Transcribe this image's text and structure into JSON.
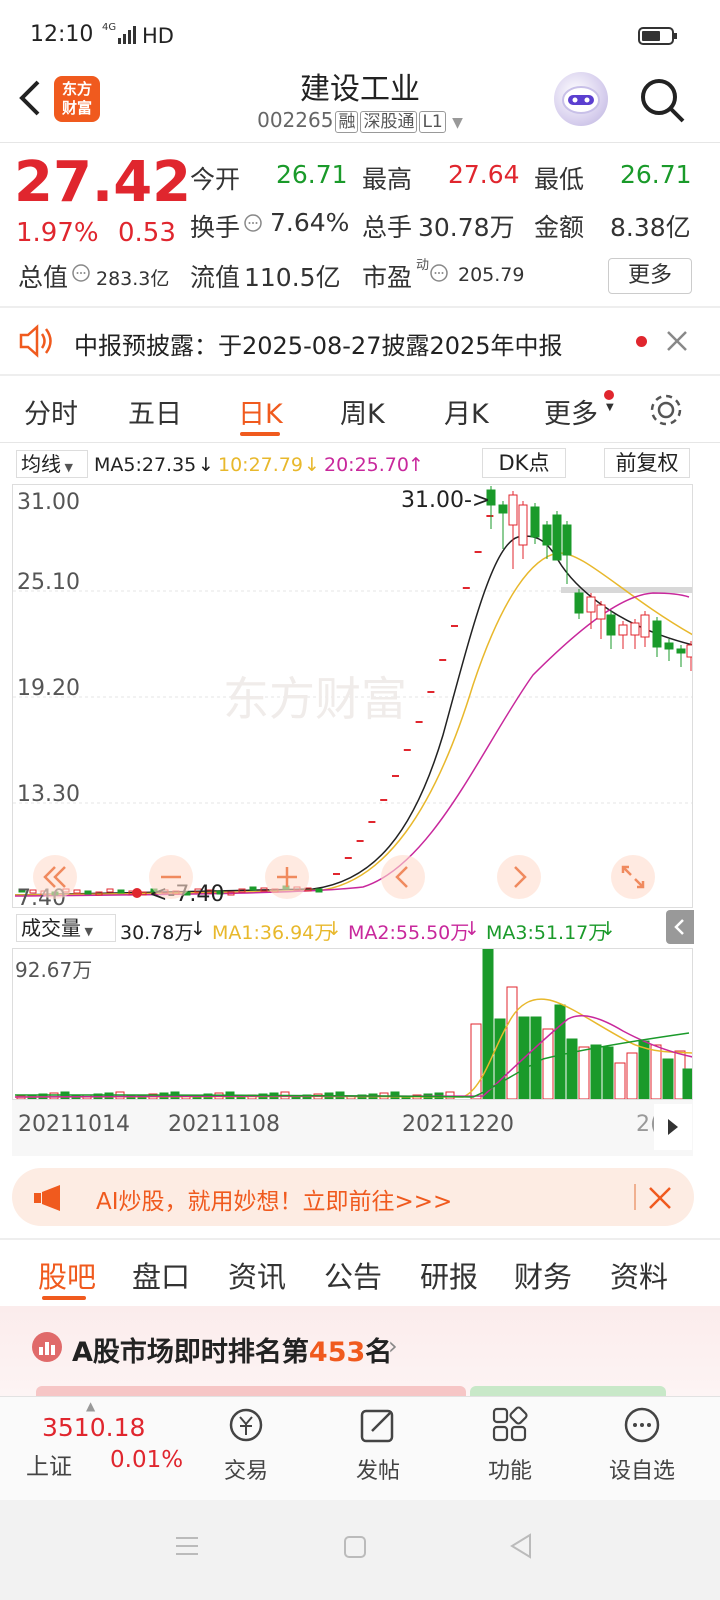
{
  "status": {
    "time": "12:10",
    "network": "4G",
    "hd": "HD"
  },
  "header": {
    "logo_line1": "东方",
    "logo_line2": "财富",
    "title": "建设工业",
    "code": "002265",
    "tags": [
      "融",
      "深股通",
      "L1"
    ]
  },
  "quote": {
    "price": "27.42",
    "change_pct": "1.97%",
    "change": "0.53",
    "open_label": "今开",
    "open": "26.71",
    "high_label": "最高",
    "high": "27.64",
    "low_label": "最低",
    "low": "26.71",
    "turnover_label": "换手",
    "turnover": "7.64%",
    "volume_label": "总手",
    "volume": "30.78万",
    "amount_label": "金额",
    "amount": "8.38亿",
    "mktcap_label": "总值",
    "mktcap": "283.3亿",
    "float_label": "流值",
    "float": "110.5亿",
    "pe_label": "市盈",
    "pe_sup": "动",
    "pe": "205.79",
    "more_button": "更多"
  },
  "notice": {
    "text": "中报预披露：于2025-08-27披露2025年中报"
  },
  "chart_tabs": {
    "items": [
      "分时",
      "五日",
      "日K",
      "周K",
      "月K",
      "更多"
    ],
    "active": 2
  },
  "kline": {
    "ma_selector": "均线",
    "ma5": "MA5:27.35",
    "ma10": "10:27.79",
    "ma20": "20:25.70",
    "dk_button": "DK点",
    "adjust_button": "前复权",
    "y_labels": [
      "31.00",
      "25.10",
      "19.20",
      "13.30",
      "7.40"
    ],
    "high_marker": "31.00->",
    "low_marker": "<-7.40",
    "watermark": "东方财富"
  },
  "volume_panel": {
    "selector": "成交量",
    "vol": "30.78万",
    "ma1": "MA1:36.94万",
    "ma2": "MA2:55.50万",
    "ma3": "MA3:51.17万",
    "max_label": "92.67万",
    "dates": [
      "20211014",
      "20211108",
      "20211220",
      "2("
    ]
  },
  "ad": {
    "text": "AI炒股，就用妙想！立即前往>>>"
  },
  "bottom_tabs": {
    "items": [
      "股吧",
      "盘口",
      "资讯",
      "公告",
      "研报",
      "财务",
      "资料"
    ],
    "active": 0
  },
  "rank": {
    "prefix": "A股市场即时排名第",
    "number": "453",
    "suffix": "名"
  },
  "bottom_nav": {
    "index_value": "3510.18",
    "index_name": "上证",
    "index_change": "0.01%",
    "items": [
      "交易",
      "发帖",
      "功能",
      "设自选"
    ]
  },
  "colors": {
    "up": "#e0262e",
    "down": "#1a9a2a",
    "accent": "#f05a1e",
    "ma10": "#e8b82c",
    "ma20": "#c8289c"
  }
}
